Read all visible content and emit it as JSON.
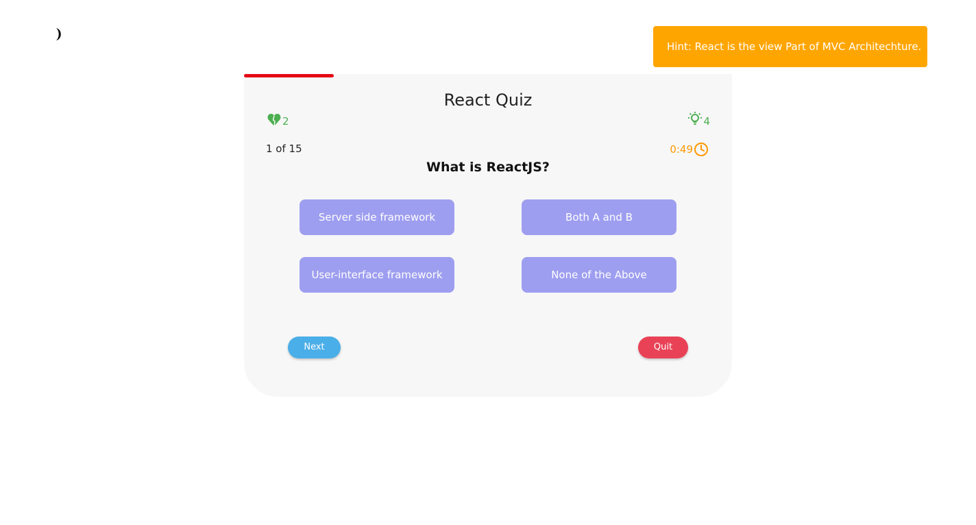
{
  "theme_toggle": {
    "icon": "moon-icon"
  },
  "hint_toast": {
    "text": "Hint: React is the view Part of MVC Architechture.",
    "color": "#ffa500"
  },
  "progress": {
    "fraction": 0.184,
    "color": "#e50914"
  },
  "quiz": {
    "title": "React Quiz",
    "lives": {
      "icon": "heart-icon",
      "count": "2"
    },
    "hints": {
      "icon": "lightbulb-icon",
      "count": "4"
    },
    "counter": "1 of 15",
    "timer": {
      "value": "0:49",
      "icon": "clock-icon"
    },
    "question": "What is ReactJS?",
    "options": [
      "Server side framework",
      "Both A and B",
      "User-interface framework",
      "None of the Above"
    ],
    "next_label": "Next",
    "quit_label": "Quit"
  },
  "colors": {
    "option_bg": "#9e9ef0",
    "next_bg": "#4aaee8",
    "quit_bg": "#e94256",
    "card_bg": "#f7f7f7",
    "status_green": "#4caf50",
    "timer_orange": "#ff9800"
  }
}
